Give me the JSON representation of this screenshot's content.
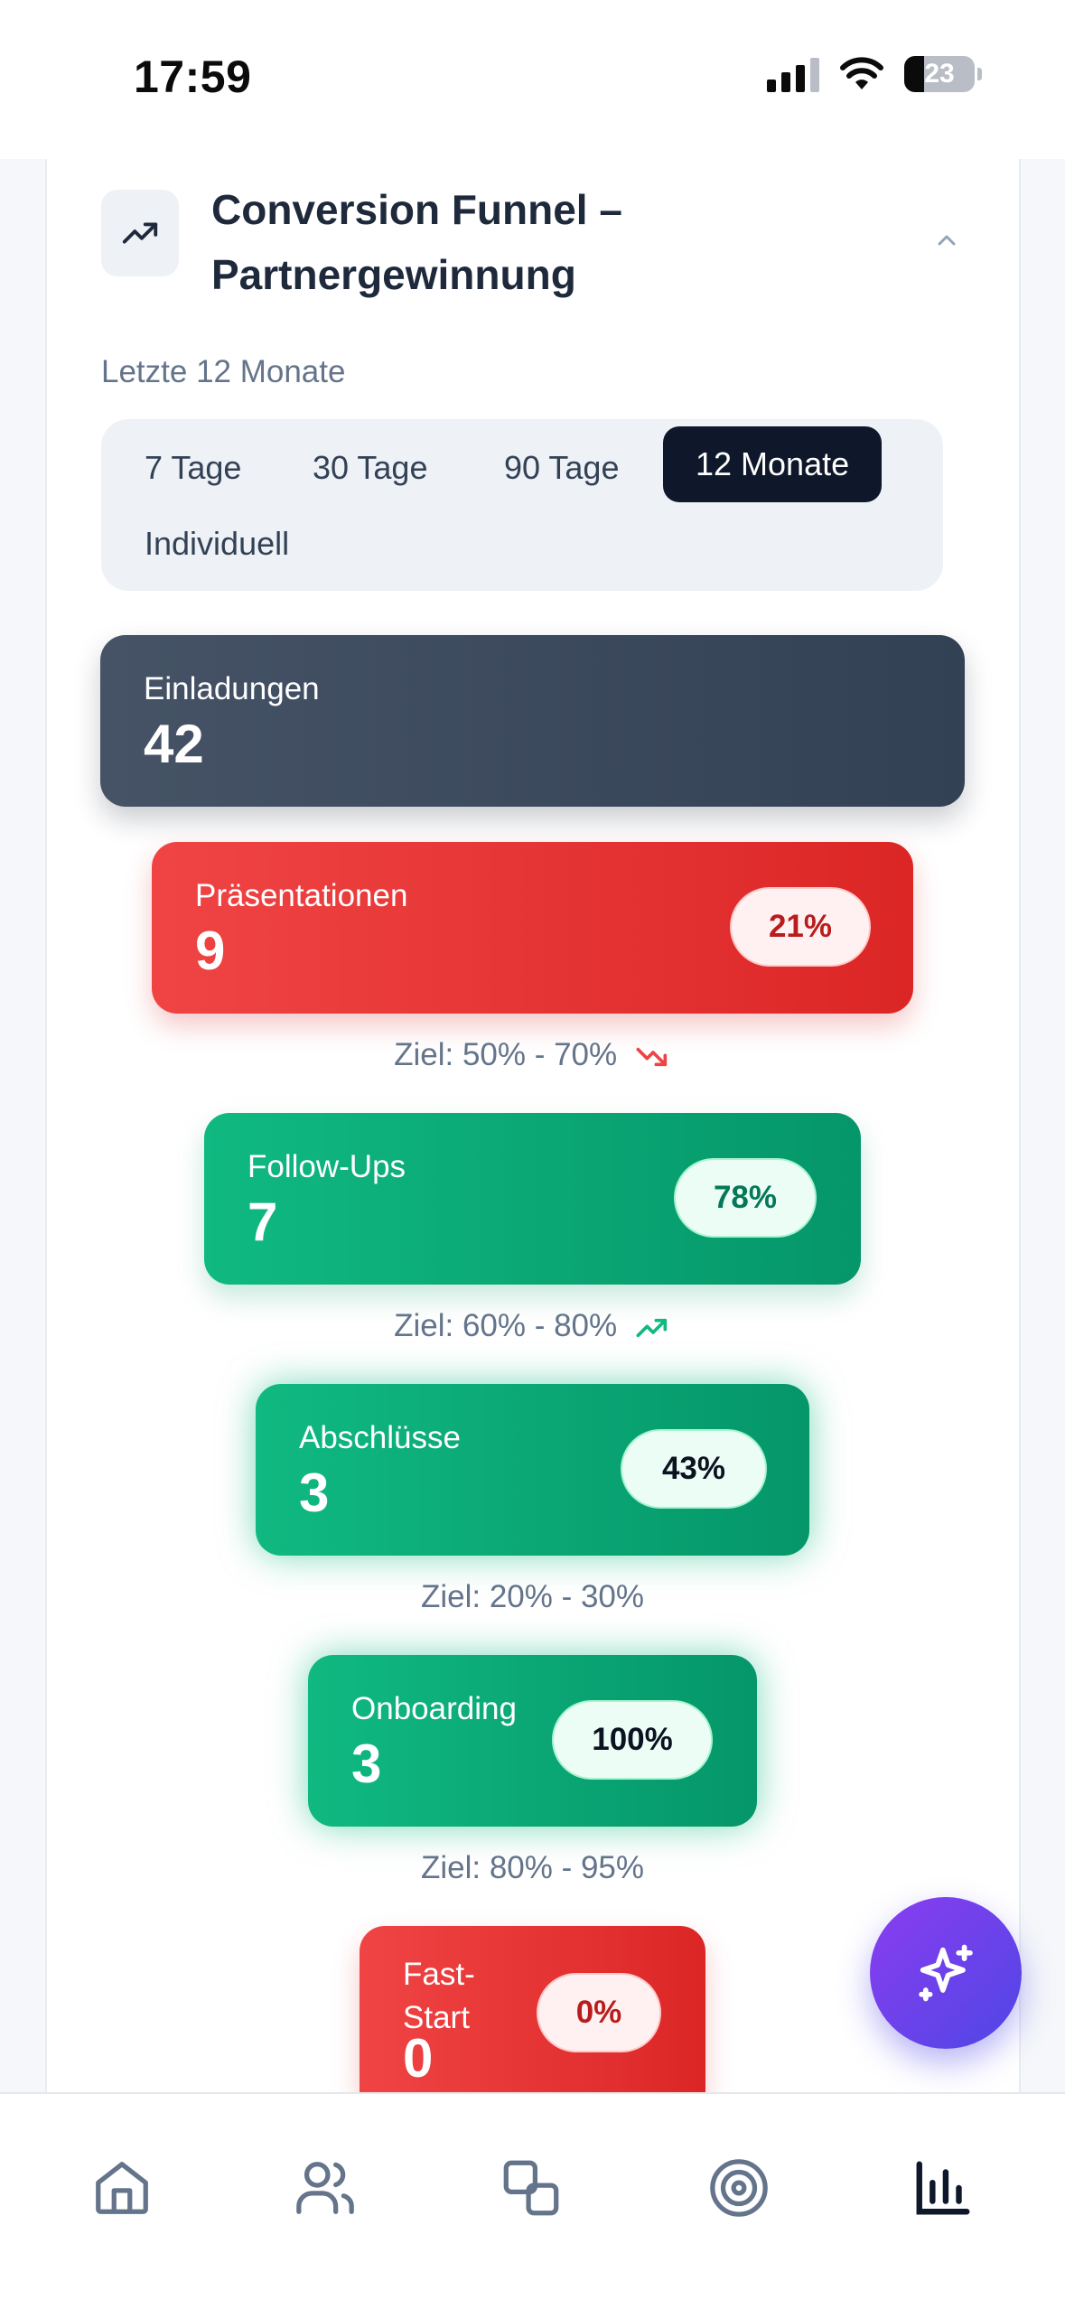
{
  "status_bar": {
    "time": "17:59",
    "battery": "23"
  },
  "card": {
    "icon": "trending-up-icon",
    "title": "Conversion Funnel – Partnergewinnung",
    "collapse_icon": "chevron-up-icon",
    "subtitle": "Letzte 12 Monate"
  },
  "range": {
    "options": [
      "7 Tage",
      "30 Tage",
      "90 Tage",
      "12 Monate",
      "Individuell"
    ],
    "selected": "12 Monate"
  },
  "funnel": [
    {
      "label": "Einladungen",
      "value": "42"
    },
    {
      "label": "Präsentationen",
      "value": "9",
      "pct": "21%",
      "goal": "Ziel: 50% - 70%",
      "trend": "down"
    },
    {
      "label": "Follow-Ups",
      "value": "7",
      "pct": "78%",
      "goal": "Ziel: 60% - 80%",
      "trend": "up"
    },
    {
      "label": "Abschlüsse",
      "value": "3",
      "pct": "43%",
      "goal": "Ziel: 20% - 30%"
    },
    {
      "label": "Onboarding",
      "value": "3",
      "pct": "100%",
      "goal": "Ziel: 80% - 95%"
    },
    {
      "label": "Fast-Start",
      "value": "0",
      "pct": "0%"
    }
  ],
  "fab": {
    "icon": "sparkles-icon"
  },
  "nav": {
    "items": [
      "home-icon",
      "users-icon",
      "copy-icon",
      "target-icon",
      "bar-chart-icon"
    ],
    "active": "bar-chart-icon"
  },
  "colors": {
    "accent_dark": "#0f172a",
    "stage_neutral": "#3f4b5e",
    "stage_bad": "#e53030",
    "stage_good": "#0ea770",
    "fab": "#6d3fe8"
  }
}
